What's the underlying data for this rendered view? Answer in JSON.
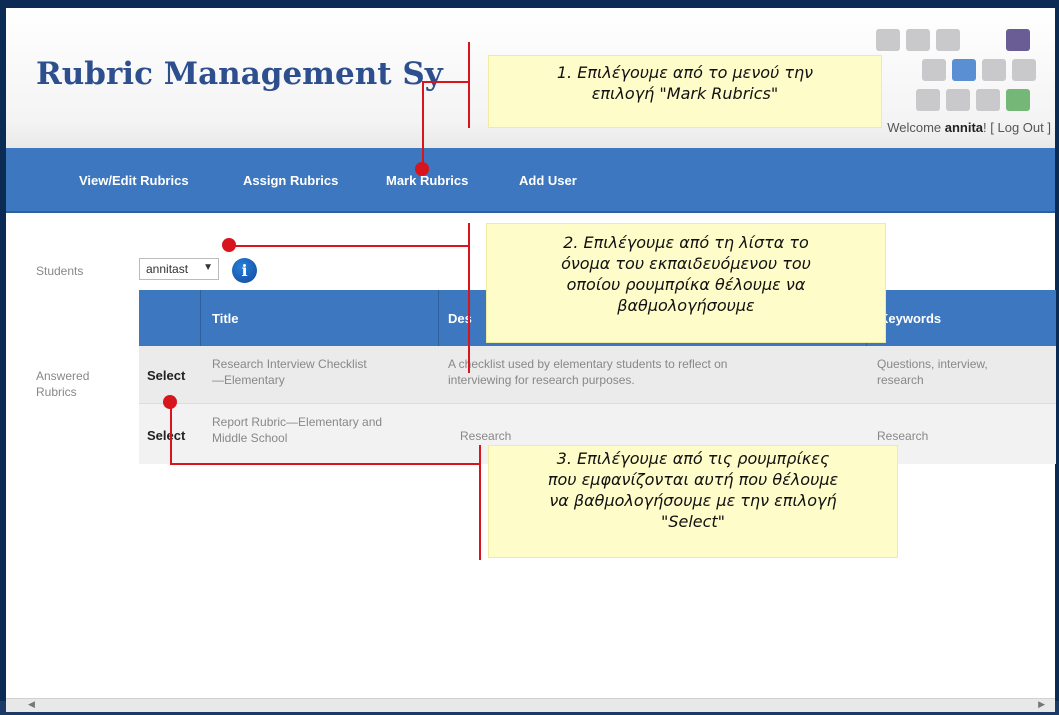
{
  "header": {
    "title": "Rubric Management Sy",
    "welcome_prefix": "Welcome ",
    "username": "annita",
    "welcome_suffix": "! [ ",
    "logout_label": "Log Out",
    "welcome_end": " ]"
  },
  "logo": {
    "colors": [
      "#c9c9cc",
      "#c9c9cc",
      "#c9c9cc",
      "#6a5d96",
      "#c9c9cc",
      "#5b8fd4",
      "#c9c9cc",
      "#c9c9cc",
      "#c9c9cc",
      "#c9c9cc",
      "#c9c9cc",
      "#75b777"
    ]
  },
  "nav": {
    "items": [
      {
        "label": "View/Edit Rubrics"
      },
      {
        "label": "Assign Rubrics"
      },
      {
        "label": "Mark Rubrics"
      },
      {
        "label": "Add User"
      }
    ]
  },
  "form": {
    "students_label": "Students",
    "student_value": "annitast",
    "answered_label_line1": "Answered",
    "answered_label_line2": "Rubrics"
  },
  "table": {
    "headers": [
      "Title",
      "Des",
      "Keywords"
    ],
    "rows": [
      {
        "action": "Select",
        "title_line1": "Research Interview Checklist",
        "title_line2": "—Elementary",
        "desc_line1": "A checklist used by elementary students to reflect on",
        "desc_line2": "interviewing for research purposes.",
        "keywords_line1": "Questions, interview,",
        "keywords_line2": "research"
      },
      {
        "action": "Select",
        "title_line1": "Report Rubric—Elementary and",
        "title_line2": "Middle School",
        "desc_line1": "Research",
        "keywords_line1": "Research"
      }
    ]
  },
  "callouts": [
    {
      "lines": [
        "1. Επιλέγουμε από το μενού την",
        "επιλογή \"Mark Rubrics\""
      ]
    },
    {
      "lines": [
        "2. Επιλέγουμε από τη λίστα το",
        "όνομα του εκπαιδευόμενου του",
        "οποίου ρουμπρίκα θέλουμε να",
        "βαθμολογήσουμε"
      ]
    },
    {
      "lines": [
        "3. Επιλέγουμε από τις ρουμπρίκες",
        "που εμφανίζονται αυτή που θέλουμε",
        "να βαθμολογήσουμε με την επιλογή",
        "\"Select\""
      ]
    }
  ],
  "colors": {
    "nav": "#3c77bf",
    "title": "#2e4f8e",
    "callout_bg": "#fefcc8",
    "pointer": "#d8141c"
  },
  "icons": [
    "info-icon",
    "chevron-down-icon",
    "scroll-left-icon",
    "scroll-right-icon"
  ]
}
